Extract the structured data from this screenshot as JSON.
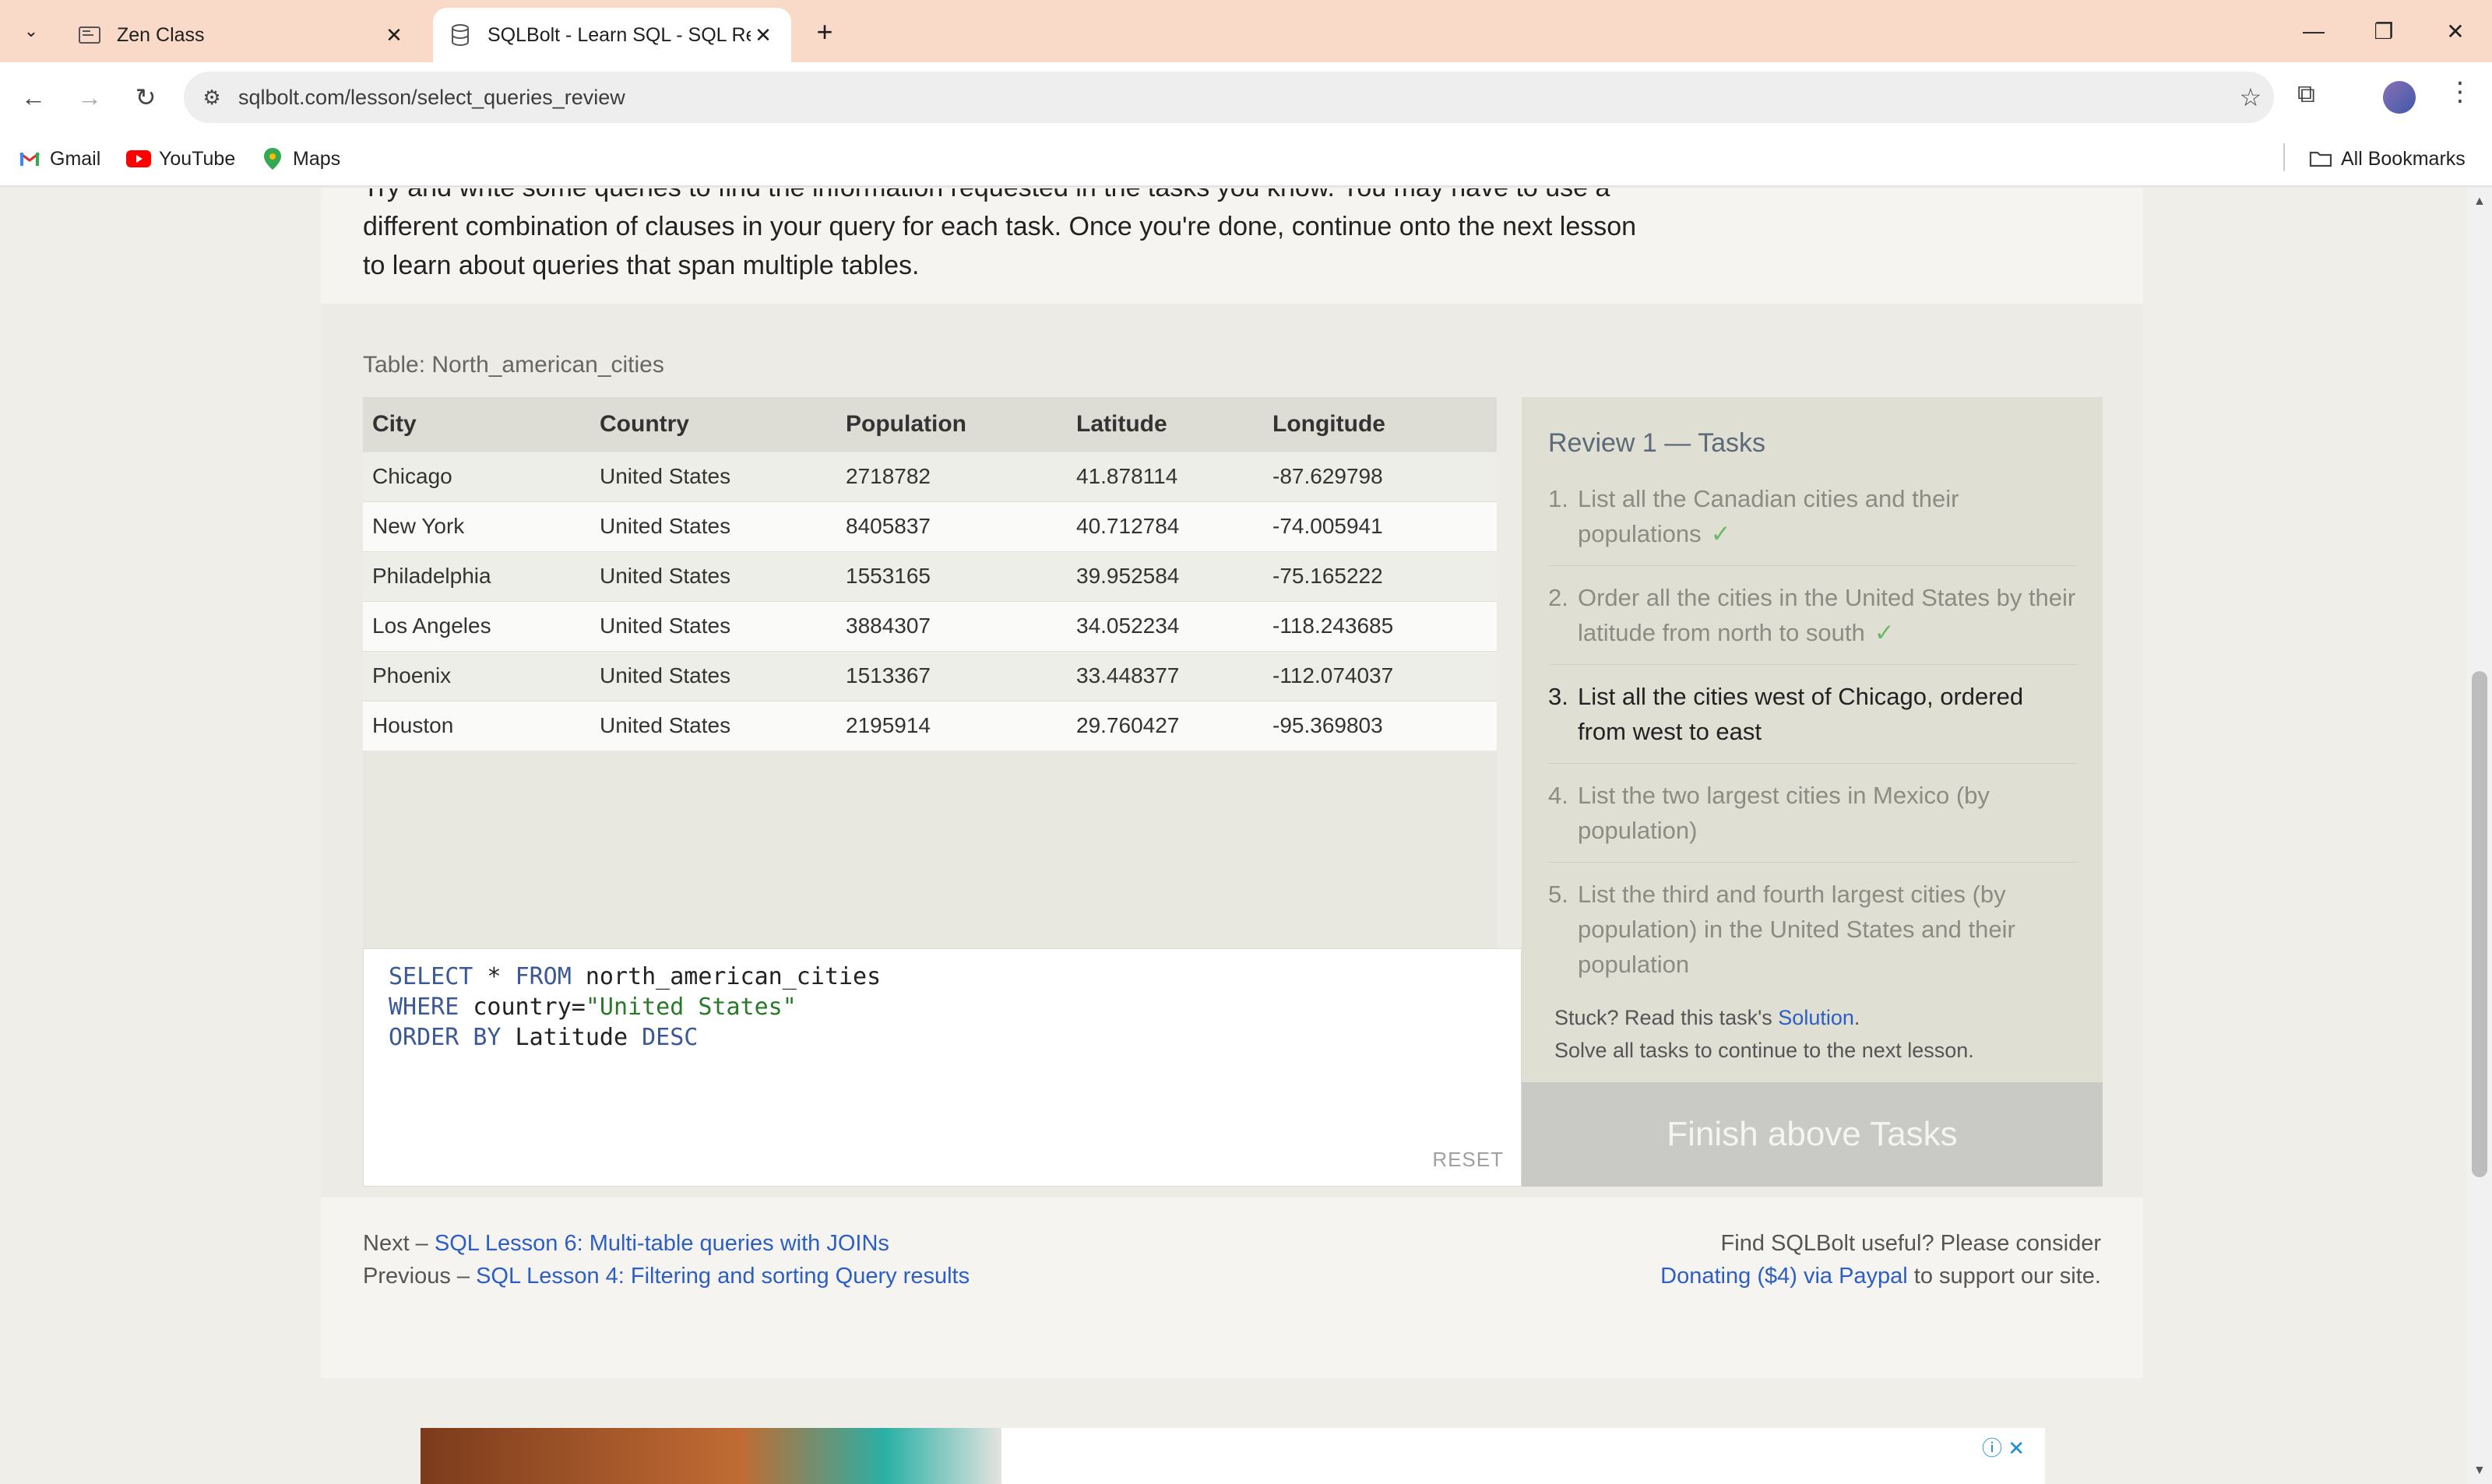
{
  "browser": {
    "tabs": [
      {
        "title": "Zen Class",
        "active": false
      },
      {
        "title": "SQLBolt - Learn SQL - SQL Review: Simple SELECT Queries",
        "active": true
      }
    ],
    "url": "sqlbolt.com/lesson/select_queries_review",
    "bookmarks": [
      {
        "label": "Gmail"
      },
      {
        "label": "YouTube"
      },
      {
        "label": "Maps"
      }
    ],
    "all_bookmarks": "All Bookmarks"
  },
  "lesson": {
    "intro": "Try and write some queries to find the information requested in the tasks you know. You may have to use a different combination of clauses in your query for each task. Once you're done, continue onto the next lesson to learn about queries that span multiple tables."
  },
  "table": {
    "caption": "Table: North_american_cities",
    "columns": [
      "City",
      "Country",
      "Population",
      "Latitude",
      "Longitude"
    ],
    "rows": [
      [
        "Chicago",
        "United States",
        "2718782",
        "41.878114",
        "-87.629798"
      ],
      [
        "New York",
        "United States",
        "8405837",
        "40.712784",
        "-74.005941"
      ],
      [
        "Philadelphia",
        "United States",
        "1553165",
        "39.952584",
        "-75.165222"
      ],
      [
        "Los Angeles",
        "United States",
        "3884307",
        "34.052234",
        "-118.243685"
      ],
      [
        "Phoenix",
        "United States",
        "1513367",
        "33.448377",
        "-112.074037"
      ],
      [
        "Houston",
        "United States",
        "2195914",
        "29.760427",
        "-95.369803"
      ]
    ]
  },
  "editor": {
    "line1": {
      "kw1": "SELECT",
      "mid": " * ",
      "kw2": "FROM",
      "rest": " north_american_cities"
    },
    "line2": {
      "kw": "WHERE",
      "rest": " country=",
      "str": "\"United States\""
    },
    "line3": {
      "kw1": "ORDER BY",
      "mid": " Latitude ",
      "kw2": "DESC"
    },
    "reset_label": "RESET"
  },
  "tasks": {
    "heading": "Review 1 — Tasks",
    "items": [
      {
        "num": "1.",
        "text": "List all the Canadian cities and their populations",
        "status": "done"
      },
      {
        "num": "2.",
        "text": "Order all the cities in the United States by their latitude from north to south",
        "status": "done"
      },
      {
        "num": "3.",
        "text": "List all the cities west of Chicago, ordered from west to east",
        "status": "current"
      },
      {
        "num": "4.",
        "text": "List the two largest cities in Mexico (by population)",
        "status": "pending"
      },
      {
        "num": "5.",
        "text": "List the third and fourth largest cities (by population) in the United States and their population",
        "status": "pending"
      }
    ],
    "check_mark": "✓",
    "stuck_prefix": "Stuck? Read this task's ",
    "solution_link": "Solution",
    "stuck_suffix": ".",
    "solve_all": "Solve all tasks to continue to the next lesson.",
    "finish_button": "Finish above Tasks"
  },
  "footer": {
    "next_prefix": "Next – ",
    "next_link": "SQL Lesson 6: Multi-table queries with JOINs",
    "prev_prefix": "Previous – ",
    "prev_link": "SQL Lesson 4: Filtering and sorting Query results",
    "useful": "Find SQLBolt useful? Please consider",
    "donate_link": "Donating ($4) via Paypal",
    "donate_suffix": " to support our site."
  }
}
